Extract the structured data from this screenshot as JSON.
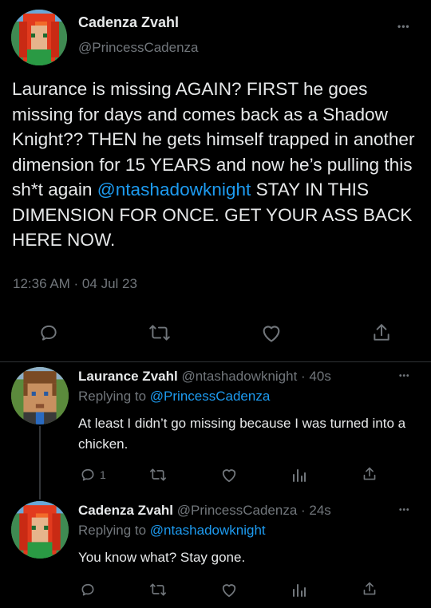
{
  "main_tweet": {
    "author_name": "Cadenza Zvahl",
    "author_handle": "@PrincessCadenza",
    "more_label": "•••",
    "text_before_mention": "Laurance is missing AGAIN? FIRST he goes missing for days and comes back as a Shadow Knight?? THEN he gets himself trapped in another dimension for 15 YEARS and now he’s pulling this sh*t again ",
    "mention": "@ntashadowknight",
    "text_after_mention": " STAY IN THIS DIMENSION FOR ONCE. GET YOUR ASS BACK HERE NOW.",
    "timestamp": "12:36 AM · 04 Jul 23",
    "actions": [
      "reply-icon",
      "retweet-icon",
      "like-icon",
      "share-icon"
    ]
  },
  "replies": [
    {
      "author_name": "Laurance Zvahl",
      "author_handle": "@ntashadowknight",
      "time": "· 40s",
      "replying_prefix": "Replying to ",
      "replying_to": "@PrincessCadenza",
      "text": "At least I didn’t go missing because I was turned into a chicken.",
      "reply_count": "1",
      "more_label": "•••"
    },
    {
      "author_name": "Cadenza Zvahl",
      "author_handle": "@PrincessCadenza",
      "time": "· 24s",
      "replying_prefix": "Replying to ",
      "replying_to": "@ntashadowknight",
      "text": "You know what? Stay gone.",
      "reply_count": "",
      "more_label": "•••"
    }
  ],
  "colors": {
    "background": "#000000",
    "text": "#e7e9ea",
    "muted": "#71767b",
    "link": "#1d9bf0",
    "divider": "#2f3336"
  }
}
